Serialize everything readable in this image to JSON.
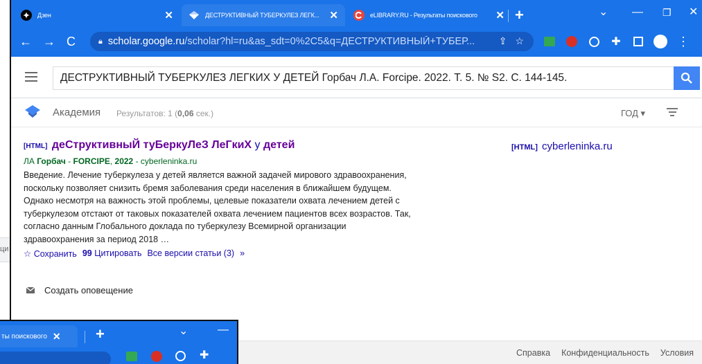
{
  "tabs": [
    {
      "title": "Дзен",
      "active": false
    },
    {
      "title": "ДЕСТРУКТИВНЫЙ ТУБЕРКУЛЕЗ ЛЕГК...",
      "active": true
    },
    {
      "title": "eLIBRARY.RU - Результаты поискового",
      "active": false
    }
  ],
  "address_bar": {
    "host": "scholar.google.ru",
    "path": "/scholar?hl=ru&as_sdt=0%2C5&q=ДЕСТРУКТИВНЫЙ+ТУБЕР..."
  },
  "search": {
    "query": "ДЕСТРУКТИВНЫЙ ТУБЕРКУЛЕЗ ЛЕГКИХ У ДЕТЕЙ Горбач Л.А. Forcipe. 2022. Т. 5. № S2. С. 144-145."
  },
  "subbar": {
    "brand": "Академия",
    "stats_prefix": "Результатов: 1 (",
    "stats_time": "0,06",
    "stats_suffix": " сек.)",
    "year_filter": "ГОД ▾"
  },
  "result": {
    "type_tag": "[HTML]",
    "title_kw": "деСтруктивныЙ туБеркуЛеЗ ЛеГкиХ",
    "title_mid": " у ",
    "title_end": "детей",
    "author_prefix": "ЛА ",
    "author": "Горбач",
    "sep1": " - ",
    "journal": "FORCIPE",
    "sep2": ", ",
    "year": "2022",
    "source": " - cyberleninka.ru",
    "snippet": "Введение. Лечение туберкулеза у детей является важной задачей мирового здравоохранения, поскольку позволяет снизить бремя заболевания среди населения в ближайшем будущем. Однако несмотря на важность этой проблемы, целевые показатели охвата лечением детей с туберкулезом отстают от таковых показателей охвата лечением пациентов всех возрастов. Так, согласно данным Глобального доклада по туберкулезу Всемирной организации здравоохранения за период 2018 …",
    "save_label": "Сохранить",
    "cite_label": "Цитировать",
    "versions_label": "Все версии статьи (3)"
  },
  "side_link": {
    "tag": "[HTML]",
    "domain": "cyberleninka.ru"
  },
  "alert_label": "Создать оповещение",
  "footer": {
    "help": "Справка",
    "privacy": "Конфиденциальность",
    "terms": "Условия"
  },
  "background_window": {
    "tab_title": "ты поискового",
    "left_text": "ци"
  },
  "colors": {
    "chrome_blue": "#1a73e8",
    "visited_title": "#660099",
    "link": "#1a0dab",
    "meta_green": "#006621"
  }
}
